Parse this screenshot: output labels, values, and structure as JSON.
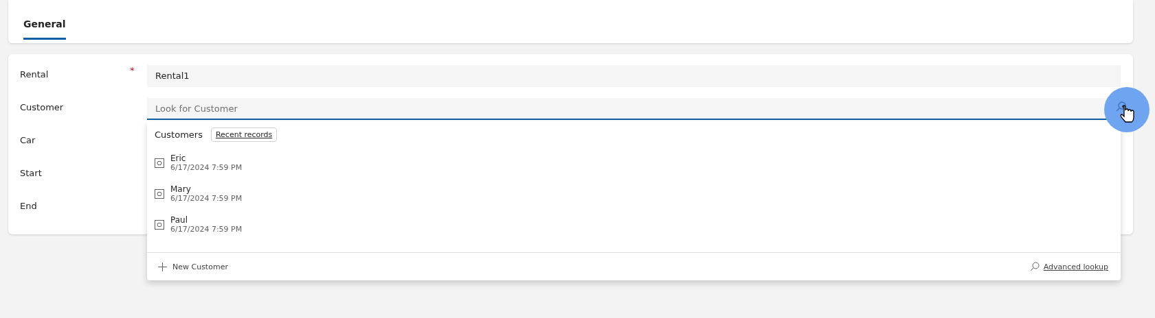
{
  "tabs": [
    {
      "label": "General",
      "selected": true
    }
  ],
  "fields": [
    {
      "label": "Rental",
      "required_mark": "*",
      "kind": "text",
      "value": "Rental1"
    },
    {
      "label": "Customer",
      "kind": "lookup",
      "placeholder": "Look for Customer"
    },
    {
      "label": "Car",
      "kind": "covered"
    },
    {
      "label": "Start",
      "kind": "covered"
    },
    {
      "label": "End",
      "kind": "covered"
    }
  ],
  "lookup_dropdown": {
    "heading": "Customers",
    "filter_button": "Recent records",
    "records": [
      {
        "name": "Eric",
        "modified": "6/17/2024 7:59 PM"
      },
      {
        "name": "Mary",
        "modified": "6/17/2024 7:59 PM"
      },
      {
        "name": "Paul",
        "modified": "6/17/2024 7:59 PM"
      }
    ],
    "new_button": "New Customer",
    "advanced_link": "Advanced lookup"
  }
}
